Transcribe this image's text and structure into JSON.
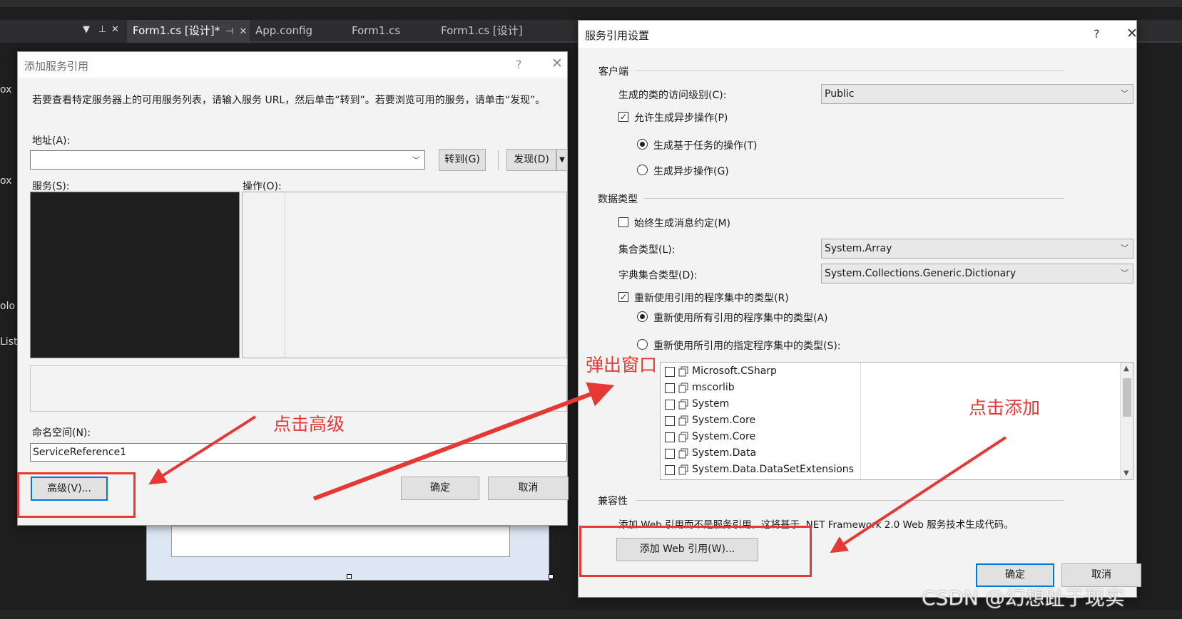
{
  "ide": {
    "tabs": [
      "Form1.cs [设计]*",
      "App.config",
      "Form1.cs",
      "Form1.cs [设计]"
    ],
    "side_labels": [
      "ox",
      "ox",
      "olo",
      "List"
    ]
  },
  "add_service_dialog": {
    "title": "添加服务引用",
    "help": "?",
    "close": "✕",
    "description": "若要查看特定服务器上的可用服务列表，请输入服务 URL，然后单击“转到”。若要浏览可用的服务，请单击“发现”。",
    "address_label": "地址(A):",
    "address_value": "",
    "go_button": "转到(G)",
    "discover_button": "发现(D)",
    "services_label": "服务(S):",
    "operations_label": "操作(O):",
    "namespace_label": "命名空间(N):",
    "namespace_value": "ServiceReference1",
    "advanced_button": "高级(V)...",
    "ok_button": "确定",
    "cancel_button": "取消"
  },
  "service_settings_dialog": {
    "title": "服务引用设置",
    "help": "?",
    "close": "✕",
    "client_group": "客户端",
    "access_level_label": "生成的类的访问级别(C):",
    "access_level_value": "Public",
    "async_checkbox": "允许生成异步操作(P)",
    "async_checked": true,
    "task_radio": "生成基于任务的操作(T)",
    "async_ops_radio": "生成异步操作(G)",
    "selected_async_mode": "task",
    "data_type_group": "数据类型",
    "always_message_checkbox": "始终生成消息约定(M)",
    "always_message_checked": false,
    "collection_label": "集合类型(L):",
    "collection_value": "System.Array",
    "dictionary_label": "字典集合类型(D):",
    "dictionary_value": "System.Collections.Generic.Dictionary",
    "reuse_checkbox": "重新使用引用的程序集中的类型(R)",
    "reuse_checked": true,
    "reuse_all_radio": "重新使用所有引用的程序集中的类型(A)",
    "reuse_specified_radio": "重新使用所引用的指定程序集中的类型(S):",
    "selected_reuse_mode": "all",
    "assemblies": [
      "Microsoft.CSharp",
      "mscorlib",
      "System",
      "System.Core",
      "System.Core",
      "System.Data",
      "System.Data.DataSetExtensions"
    ],
    "compat_group": "兼容性",
    "compat_text": "添加 Web 引用而不是服务引用。这将基于 .NET Framework 2.0 Web 服务技术生成代码。",
    "add_web_ref_button": "添加 Web 引用(W)...",
    "ok_button": "确定",
    "cancel_button": "取消"
  },
  "annotations": {
    "click_advanced": "点击高级",
    "popup_window": "弹出窗口",
    "click_add": "点击添加",
    "color": "#e53935"
  },
  "watermark": "CSDN @幻想趾于现实"
}
